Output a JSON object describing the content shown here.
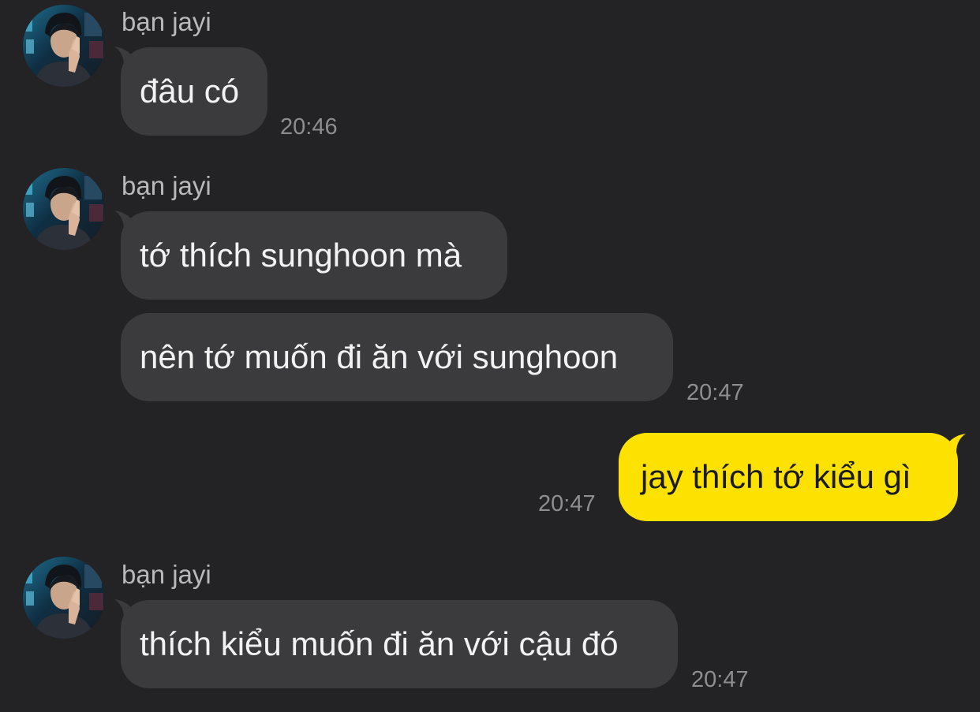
{
  "colors": {
    "background": "#232325",
    "incoming_bubble": "#3b3b3d",
    "outgoing_bubble": "#fde100",
    "incoming_text": "#f2f2f2",
    "outgoing_text": "#1b1b1b",
    "sender_name": "#b9b9bb",
    "timestamp": "#8e8e90"
  },
  "chat": {
    "groups": [
      {
        "sender": "bạn jayi",
        "avatar": "contact-avatar-photo",
        "messages": [
          "đâu có"
        ],
        "time": "20:46"
      },
      {
        "sender": "bạn jayi",
        "avatar": "contact-avatar-photo",
        "messages": [
          "tớ thích sunghoon mà",
          "nên tớ muốn đi ăn với sunghoon"
        ],
        "time": "20:47"
      },
      {
        "outgoing": true,
        "messages": [
          "jay thích tớ kiểu gì"
        ],
        "time": "20:47"
      },
      {
        "sender": "bạn jayi",
        "avatar": "contact-avatar-photo",
        "messages": [
          "thích kiểu muốn đi ăn với cậu đó"
        ],
        "time": "20:47"
      }
    ]
  }
}
